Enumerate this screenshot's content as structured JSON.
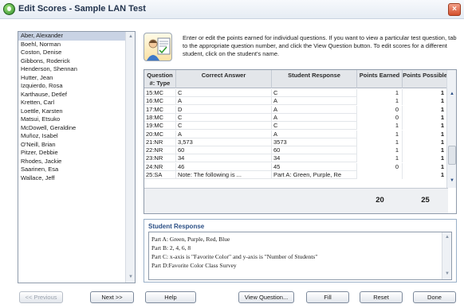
{
  "window": {
    "title": "Edit Scores - Sample LAN Test",
    "close_icon": "×"
  },
  "students": {
    "items": [
      "Aber, Alexander",
      "Boehl, Norman",
      "Coston, Denise",
      "Gibbons, Roderick",
      "Henderson, Shennan",
      "Hutter, Jean",
      "Izquierdo, Rosa",
      "Karthause, Detlef",
      "Kretten, Carl",
      "Loettle, Karsten",
      "Matsui, Etsuko",
      "McDowell, Geraldine",
      "Muñoz, Isabel",
      "O'Neill, Brian",
      "Pitzer, Debbie",
      "Rhodes, Jackie",
      "Saarinen, Esa",
      "Wallace, Jeff"
    ],
    "selected_index": 0
  },
  "instructions": "Enter or edit the points earned for individual questions. If you want to view a particular test question, tab to the appropriate question number, and click the View Question button. To edit scores for a different student, click on the student's name.",
  "grid": {
    "columns": [
      "Question #: Type",
      "Correct Answer",
      "Student Response",
      "Points Earned",
      "Points Possible"
    ],
    "rows": [
      {
        "q": "15:MC",
        "correct": "C",
        "response": "C",
        "earned": "1",
        "possible": "1"
      },
      {
        "q": "16:MC",
        "correct": "A",
        "response": "A",
        "earned": "1",
        "possible": "1"
      },
      {
        "q": "17:MC",
        "correct": "D",
        "response": "A",
        "earned": "0",
        "possible": "1"
      },
      {
        "q": "18:MC",
        "correct": "C",
        "response": "A",
        "earned": "0",
        "possible": "1"
      },
      {
        "q": "19:MC",
        "correct": "C",
        "response": "C",
        "earned": "1",
        "possible": "1"
      },
      {
        "q": "20:MC",
        "correct": "A",
        "response": "A",
        "earned": "1",
        "possible": "1"
      },
      {
        "q": "21:NR",
        "correct": "3,573",
        "response": "3573",
        "earned": "1",
        "possible": "1"
      },
      {
        "q": "22:NR",
        "correct": "60",
        "response": "60",
        "earned": "1",
        "possible": "1"
      },
      {
        "q": "23:NR",
        "correct": "34",
        "response": "34",
        "earned": "1",
        "possible": "1"
      },
      {
        "q": "24:NR",
        "correct": "46",
        "response": "45",
        "earned": "0",
        "possible": "1"
      },
      {
        "q": "25:SA",
        "correct": "Note: The following is ...",
        "response": "Part A: Green, Purple, Re",
        "earned": "",
        "possible": "1"
      }
    ],
    "total_earned": "20",
    "total_possible": "25"
  },
  "response": {
    "title": "Student Response",
    "lines": [
      "Part A: Green, Purple, Red, Blue",
      "Part B: 2, 4, 6, 8",
      "Part C: x-axis is \"Favorite Color\" and y-axis is \"Number of Students\"",
      "Part D:Favorite Color Class Survey"
    ]
  },
  "buttons": {
    "previous": "<< Previous",
    "next": "Next >>",
    "help": "Help",
    "view_question": "View Question...",
    "fill": "Fill",
    "reset": "Reset",
    "done": "Done"
  },
  "icons": {
    "app": "test-app-icon",
    "instructions": "student-paper-icon"
  },
  "colors": {
    "selected_row": "#c9d3e4",
    "header": "#e3e6ea",
    "response_title": "#2b4f85",
    "close_button": "#d4502d"
  }
}
